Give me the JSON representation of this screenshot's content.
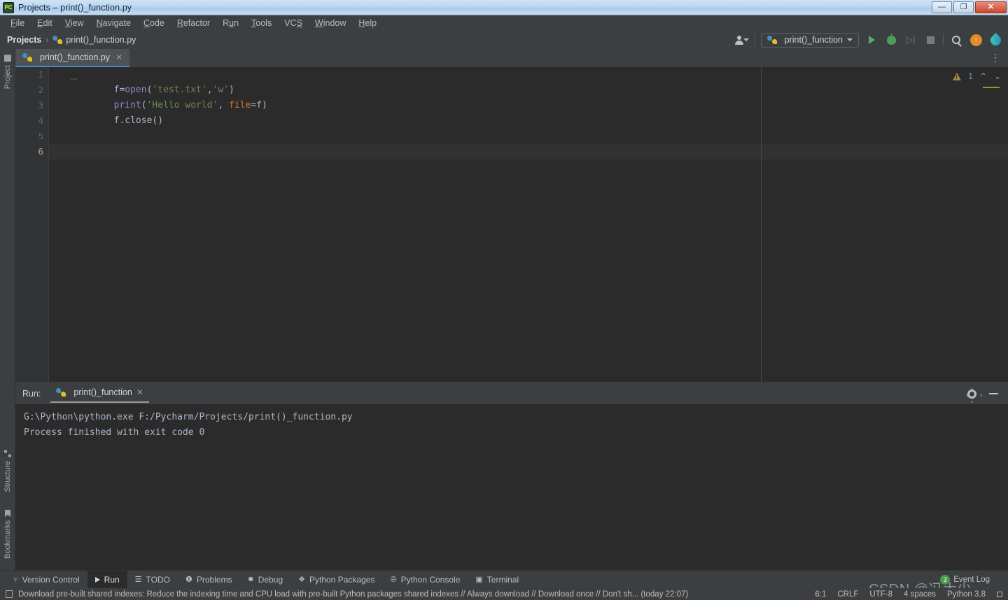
{
  "window": {
    "title": "Projects – print()_function.py",
    "app_icon": "pycharm-icon",
    "minimize_label": "—",
    "restore_label": "❐",
    "close_label": "✕"
  },
  "menubar": {
    "items": [
      {
        "label": "File",
        "mnemonic": "F"
      },
      {
        "label": "Edit",
        "mnemonic": "E"
      },
      {
        "label": "View",
        "mnemonic": "V"
      },
      {
        "label": "Navigate",
        "mnemonic": "N"
      },
      {
        "label": "Code",
        "mnemonic": "C"
      },
      {
        "label": "Refactor",
        "mnemonic": "R"
      },
      {
        "label": "Run",
        "mnemonic": "u"
      },
      {
        "label": "Tools",
        "mnemonic": "T"
      },
      {
        "label": "VCS",
        "mnemonic": "S"
      },
      {
        "label": "Window",
        "mnemonic": "W"
      },
      {
        "label": "Help",
        "mnemonic": "H"
      }
    ]
  },
  "navbar": {
    "breadcrumbs": [
      {
        "label": "Projects",
        "icon": "folder-icon"
      },
      {
        "label": "print()_function.py",
        "icon": "python-file-icon"
      }
    ],
    "separator": "›",
    "run_config": "print()_function",
    "actions": [
      {
        "name": "run-button",
        "label": "Run"
      },
      {
        "name": "debug-button",
        "label": "Debug"
      },
      {
        "name": "run-coverage-button",
        "label": "Run with Coverage"
      },
      {
        "name": "stop-button",
        "label": "Stop"
      },
      {
        "name": "search-everywhere-button",
        "label": "Search Everywhere"
      },
      {
        "name": "updates-button",
        "label": "Updates"
      },
      {
        "name": "ai-assistant-button",
        "label": "AI Assistant"
      }
    ]
  },
  "left_strip": {
    "tabs": [
      {
        "label": "Project",
        "icon": "folder-icon"
      },
      {
        "label": "Structure",
        "icon": "structure-icon"
      },
      {
        "label": "Bookmarks",
        "icon": "bookmark-icon"
      }
    ]
  },
  "editor": {
    "tab": {
      "label": "print()_function.py",
      "icon": "python-file-icon",
      "close": "✕"
    },
    "more_actions": "⋮",
    "line_numbers": [
      "1",
      "2",
      "3",
      "4",
      "5",
      "6"
    ],
    "current_line": 6,
    "cursor_position": "6:1",
    "inspections": {
      "warning_count": "1",
      "prev": "⌃",
      "next": "⌄"
    },
    "lines": [
      {
        "number": 1,
        "tokens": [
          {
            "text": "f",
            "type": "default"
          },
          {
            "text": "=",
            "type": "default"
          },
          {
            "text": "open",
            "type": "function"
          },
          {
            "text": "(",
            "type": "default"
          },
          {
            "text": "'test.txt'",
            "type": "string"
          },
          {
            "text": ",",
            "type": "default"
          },
          {
            "text": "'w'",
            "type": "string"
          },
          {
            "text": ")",
            "type": "default"
          }
        ]
      },
      {
        "number": 2,
        "tokens": [
          {
            "text": "print",
            "type": "function"
          },
          {
            "text": "(",
            "type": "default"
          },
          {
            "text": "'Hello world'",
            "type": "string"
          },
          {
            "text": ", ",
            "type": "default"
          },
          {
            "text": "file",
            "type": "keyword"
          },
          {
            "text": "=f)",
            "type": "default"
          }
        ]
      },
      {
        "number": 3,
        "tokens": [
          {
            "text": "f.close()",
            "type": "default"
          }
        ]
      }
    ]
  },
  "run_window": {
    "label": "Run:",
    "tab": {
      "label": "print()_function",
      "icon": "python-file-icon",
      "close": "✕"
    },
    "settings_icon": "gear-icon",
    "hide_icon": "minimize-icon",
    "output": [
      "G:\\Python\\python.exe F:/Pycharm/Projects/print()_function.py",
      "",
      "Process finished with exit code 0"
    ]
  },
  "bottom_bar": {
    "tabs": [
      {
        "label": "Version Control",
        "icon": "branch-icon",
        "active": false
      },
      {
        "label": "Run",
        "icon": "play-icon",
        "active": true
      },
      {
        "label": "TODO",
        "icon": "list-icon",
        "active": false
      },
      {
        "label": "Problems",
        "icon": "error-icon",
        "active": false
      },
      {
        "label": "Debug",
        "icon": "bug-icon",
        "active": false
      },
      {
        "label": "Python Packages",
        "icon": "packages-icon",
        "active": false
      },
      {
        "label": "Python Console",
        "icon": "python-icon",
        "active": false
      },
      {
        "label": "Terminal",
        "icon": "terminal-icon",
        "active": false
      }
    ]
  },
  "status_bar": {
    "message": "Download pre-built shared indexes: Reduce the indexing time and CPU load with pre-built Python packages shared indexes // Always download // Download once // Don't sh... (today 22:07)",
    "message_icon": "notification-icon",
    "caret": "6:1",
    "line_separator": "CRLF",
    "encoding": "UTF-8",
    "indent": "4 spaces",
    "interpreter": "Python 3.8",
    "lock_icon": "lock-icon",
    "event_log": {
      "label": "Event Log",
      "count": "3"
    }
  },
  "watermark": {
    "text": "CSDN @冯大少"
  },
  "colors": {
    "editor_bg": "#2b2b2b",
    "panel_bg": "#3c3f41",
    "gutter_bg": "#313335",
    "accent_blue": "#4a88c7",
    "run_green": "#59a869",
    "string_green": "#6a8759",
    "keyword_orange": "#cc7832",
    "function_purple": "#8888c6",
    "default_text": "#a9b7c6",
    "warning_yellow": "#a8884a"
  }
}
